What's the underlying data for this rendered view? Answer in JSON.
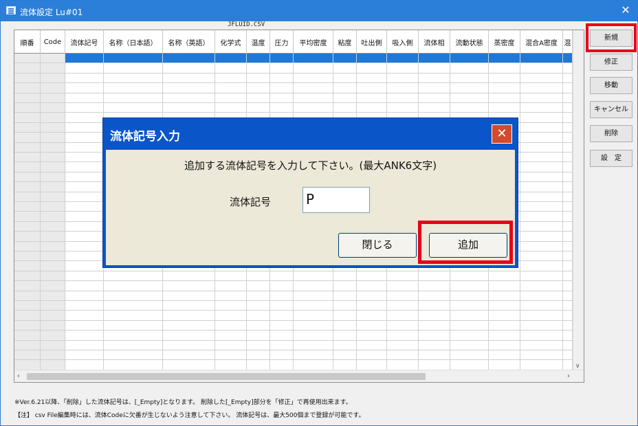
{
  "window": {
    "title": "流体設定 Lu#01",
    "close_glyph": "✕"
  },
  "grid": {
    "filename": "JFLUID.CSV",
    "columns": [
      "順番",
      "Code",
      "流体記号",
      "名称（日本語）",
      "名称（英語）",
      "化学式",
      "温度",
      "圧力",
      "平均密度",
      "粘度",
      "吐出側",
      "吸入側",
      "流体相",
      "流動状態",
      "蒸密度",
      "混合A密度",
      "混"
    ]
  },
  "side_buttons": [
    "新規",
    "修正",
    "移動",
    "キャンセル",
    "削除",
    "設　定"
  ],
  "footer": {
    "line1": "※Ver.6.21以降、「削除」した流体記号は、[_Empty]となります。 削除した[_Empty]部分を「修正」で再使用出来ます。",
    "line2": "【注】 csv File編集時には、流体Codeに欠番が生じないよう注意して下さい。 流体記号は、最大500個まで登録が可能です。"
  },
  "dialog": {
    "title": "流体記号入力",
    "close_glyph": "✕",
    "message": "追加する流体記号を入力して下さい。(最大ANK6文字)",
    "field_label": "流体記号",
    "field_value": "P",
    "close_button": "閉じる",
    "add_button": "追加"
  },
  "colors": {
    "titlebar": "#2b7fd9",
    "selection": "#1e78d8",
    "dialog_frame": "#0a56c8",
    "highlight": "#e6001a"
  }
}
